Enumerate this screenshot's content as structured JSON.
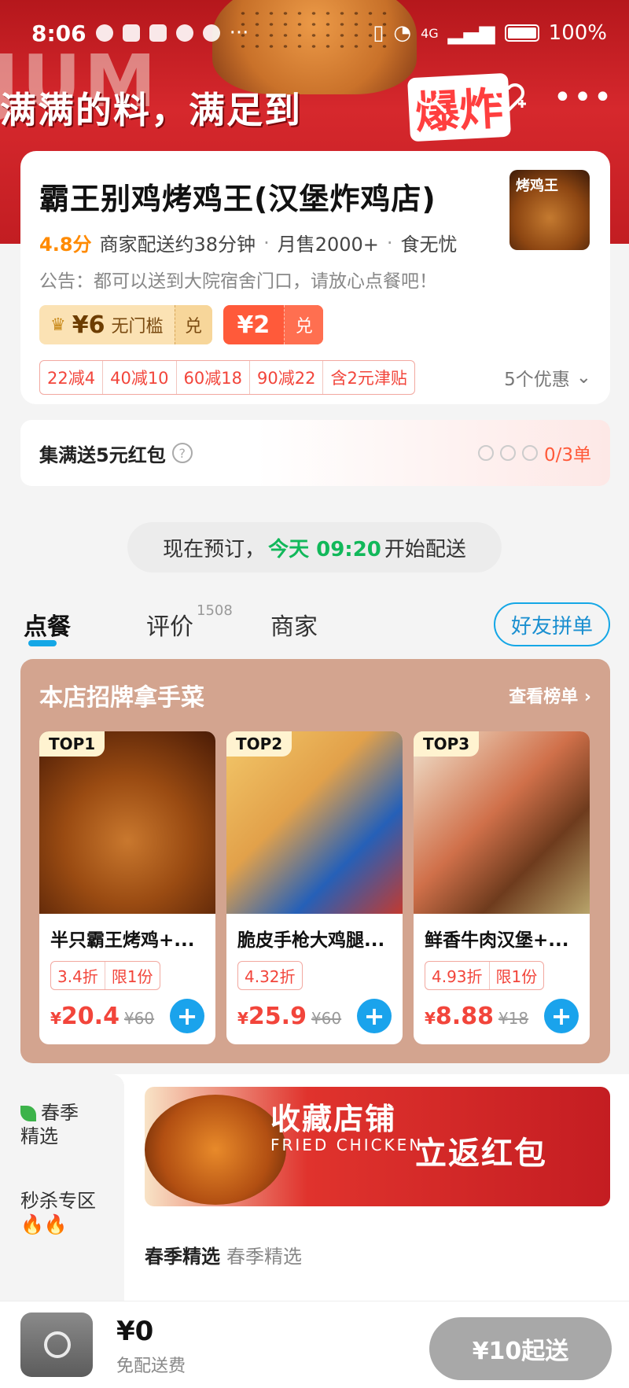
{
  "status_bar": {
    "time": "8:06",
    "network": "4G",
    "battery": "100%"
  },
  "banner": {
    "word": "JUM",
    "slogan": "满满的料，满足到",
    "slogan_accent": "爆炸"
  },
  "shop": {
    "name": "霸王别鸡烤鸡王(汉堡炸鸡店)",
    "thumb_text": "烤鸡王",
    "rating": "4.8分",
    "delivery": "商家配送约38分钟",
    "monthly_sales": "月售2000+",
    "guarantee": "食无忧",
    "notice": "公告：都可以送到大院宿舍门口，请放心点餐吧！",
    "coupons": [
      {
        "amount": "¥6",
        "desc": "无门槛",
        "action": "兑"
      },
      {
        "amount": "¥2",
        "action": "兑"
      }
    ],
    "promos": [
      "22减4",
      "40减10",
      "60减18",
      "90减22",
      "含2元津贴"
    ],
    "promo_more": "5个优惠"
  },
  "collect": {
    "title": "集满送5元红包",
    "progress": "0/3单"
  },
  "preorder": {
    "prefix": "现在预订，",
    "time": "今天 09:20",
    "suffix": "开始配送"
  },
  "tabs": [
    {
      "label": "点餐"
    },
    {
      "label": "评价",
      "count": "1508"
    },
    {
      "label": "商家"
    }
  ],
  "group_button": "好友拼单",
  "signature": {
    "title": "本店招牌拿手菜",
    "more": "查看榜单 ›",
    "dishes": [
      {
        "rank": "TOP1",
        "name": "半只霸王烤鸡+...",
        "tags": [
          "3.4折",
          "限1份"
        ],
        "price": "20.4",
        "old_price": "¥60"
      },
      {
        "rank": "TOP2",
        "name": "脆皮手枪大鸡腿...",
        "tags": [
          "4.32折"
        ],
        "price": "25.9",
        "old_price": "¥60"
      },
      {
        "rank": "TOP3",
        "name": "鲜香牛肉汉堡+...",
        "tags": [
          "4.93折",
          "限1份"
        ],
        "price": "8.88",
        "old_price": "¥18"
      }
    ]
  },
  "side_nav": [
    {
      "label": "春季\n精选"
    },
    {
      "label": "秒杀专区\n🔥🔥"
    }
  ],
  "promo_banner": {
    "title": "收藏店铺",
    "subtitle": "FRIED CHICKEN",
    "title2": "立返红包"
  },
  "section": {
    "title": "春季精选",
    "subtitle": "春季精选"
  },
  "bottom_bar": {
    "price": "¥0",
    "delivery_fee": "免配送费",
    "checkout": "¥10起送"
  }
}
